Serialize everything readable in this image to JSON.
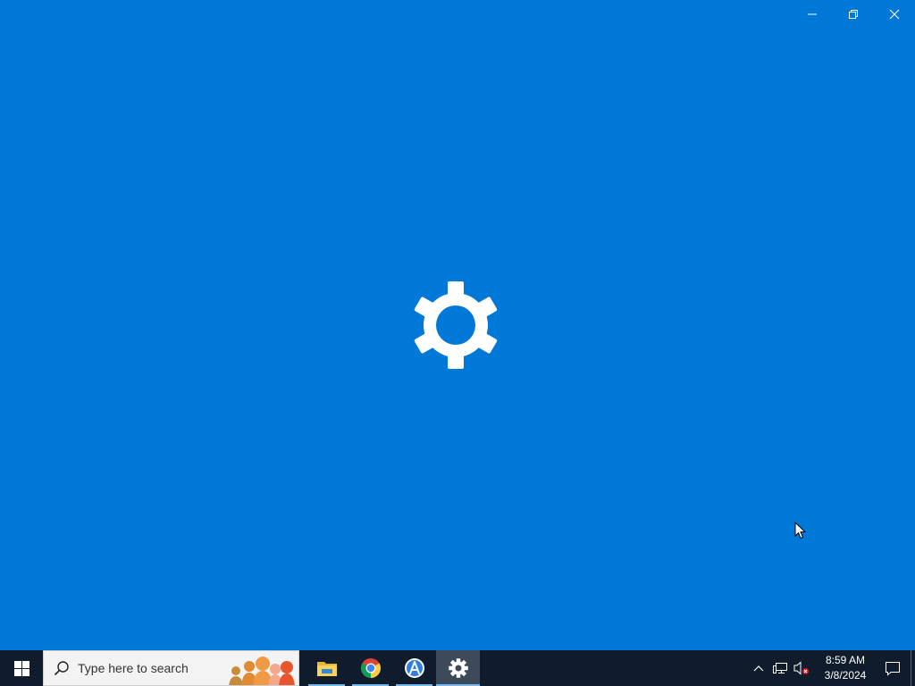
{
  "window": {
    "caption_buttons": [
      {
        "name": "minimize",
        "icon": "minimize-icon"
      },
      {
        "name": "restore",
        "icon": "restore-icon"
      },
      {
        "name": "close",
        "icon": "close-icon"
      }
    ],
    "splash_icon": "gear-icon",
    "background_color": "#0078d7"
  },
  "taskbar": {
    "background_color": "#101c2b",
    "start_icon": "windows-logo-icon",
    "search": {
      "placeholder": "Type here to search",
      "icon": "search-icon"
    },
    "apps": [
      {
        "name": "File Explorer",
        "icon": "folder-icon",
        "state": "open"
      },
      {
        "name": "Google Chrome",
        "icon": "chrome-icon",
        "state": "open"
      },
      {
        "name": "App Installer",
        "icon": "app-store-icon",
        "state": "open"
      },
      {
        "name": "Settings",
        "icon": "gear-icon",
        "state": "active"
      }
    ],
    "tray": {
      "icons": [
        "chevron-up-icon",
        "network-icon",
        "volume-muted-icon"
      ],
      "time": "8:59 AM",
      "date": "3/8/2024",
      "notification_icon": "notification-icon"
    }
  }
}
